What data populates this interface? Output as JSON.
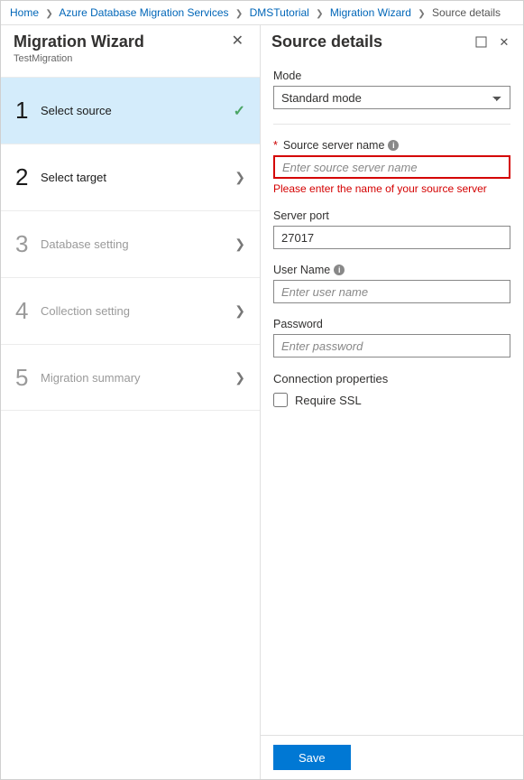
{
  "breadcrumb": {
    "items": [
      {
        "label": "Home"
      },
      {
        "label": "Azure Database Migration Services"
      },
      {
        "label": "DMSTutorial"
      },
      {
        "label": "Migration Wizard"
      }
    ],
    "current": "Source details"
  },
  "left": {
    "title": "Migration Wizard",
    "subtitle": "TestMigration",
    "steps": [
      {
        "num": "1",
        "label": "Select source",
        "state": "selected-checked"
      },
      {
        "num": "2",
        "label": "Select target",
        "state": "active"
      },
      {
        "num": "3",
        "label": "Database setting",
        "state": "inactive"
      },
      {
        "num": "4",
        "label": "Collection setting",
        "state": "inactive"
      },
      {
        "num": "5",
        "label": "Migration summary",
        "state": "inactive"
      }
    ]
  },
  "right": {
    "title": "Source details",
    "mode": {
      "label": "Mode",
      "value": "Standard mode"
    },
    "sourceServer": {
      "label": "Source server name",
      "placeholder": "Enter source server name",
      "value": "",
      "error": "Please enter the name of your source server"
    },
    "serverPort": {
      "label": "Server port",
      "value": "27017"
    },
    "userName": {
      "label": "User Name",
      "placeholder": "Enter user name",
      "value": ""
    },
    "password": {
      "label": "Password",
      "placeholder": "Enter password",
      "value": ""
    },
    "connection": {
      "heading": "Connection properties",
      "requireSsl": "Require SSL"
    },
    "saveLabel": "Save"
  }
}
